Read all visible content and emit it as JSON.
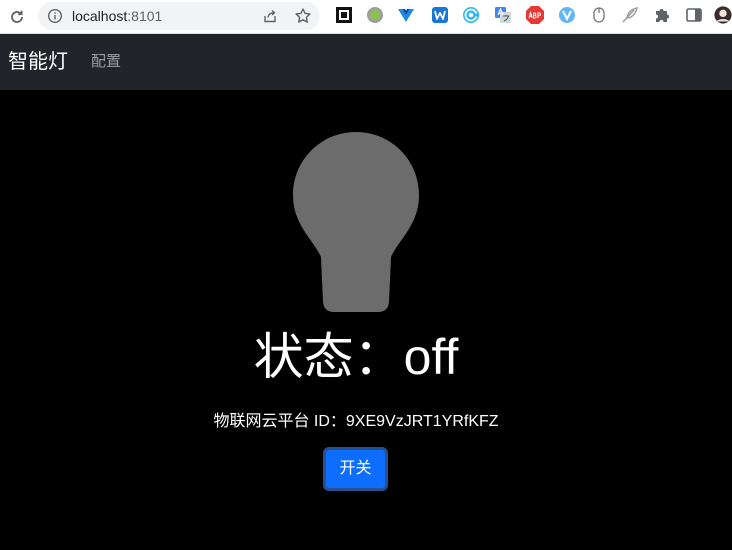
{
  "browser": {
    "url_host": "localhost",
    "url_port": ":8101",
    "extensions": [
      "qr-code-icon",
      "circle-extension-icon",
      "vue-devtools-icon",
      "w-extension-icon",
      "c-extension-icon",
      "translate-icon",
      "adblock-plus-icon",
      "v-extension-icon",
      "mouse-icon",
      "feather-icon",
      "puzzle-icon",
      "side-panel-icon",
      "profile-avatar"
    ],
    "colors": {
      "omnibox_bg": "#f1f3f4"
    }
  },
  "navbar": {
    "brand": "智能灯",
    "links": [
      {
        "label": "配置"
      }
    ]
  },
  "lamp": {
    "status_label": "状态：",
    "status_value": "off",
    "platform_label": "物联网云平台 ID：",
    "platform_id": "9XE9VzJRT1YRfKFZ",
    "toggle_label": "开关",
    "bulb_color": "#6c6c6c",
    "button_color": "#0d6efd"
  }
}
